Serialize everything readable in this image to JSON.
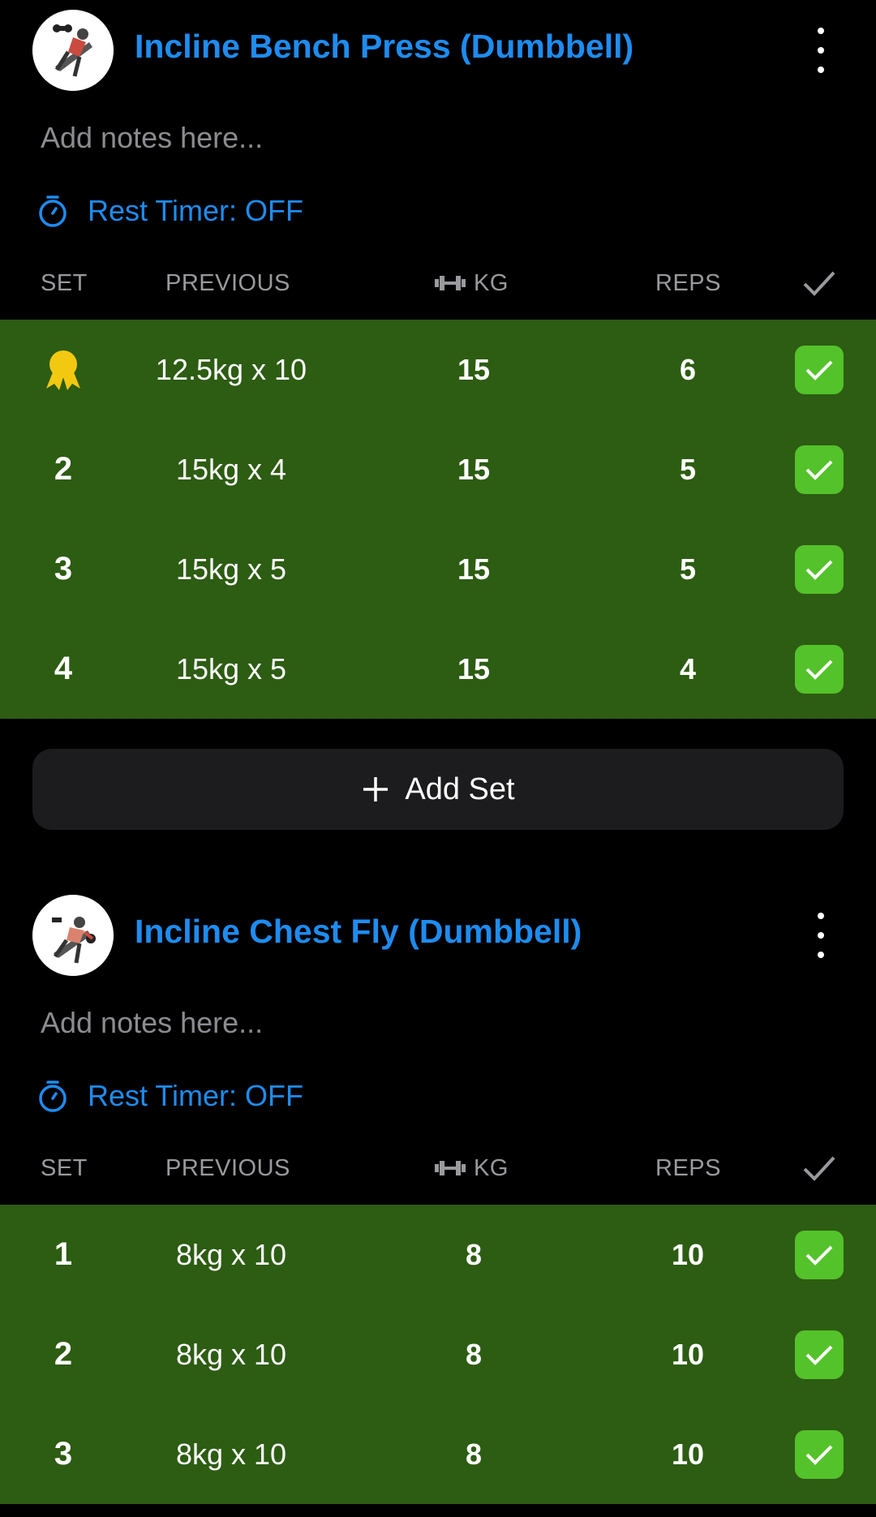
{
  "exercises": [
    {
      "title": "Incline Bench Press (Dumbbell)",
      "notes_placeholder": "Add notes here...",
      "rest_timer": "Rest Timer: OFF",
      "columns": {
        "set": "SET",
        "previous": "PREVIOUS",
        "kg": "KG",
        "reps": "REPS"
      },
      "sets": [
        {
          "set": "",
          "set_icon": "medal-icon",
          "previous": "12.5kg x 10",
          "kg": "15",
          "reps": "6",
          "done": true
        },
        {
          "set": "2",
          "previous": "15kg x 4",
          "kg": "15",
          "reps": "5",
          "done": true
        },
        {
          "set": "3",
          "previous": "15kg x 5",
          "kg": "15",
          "reps": "5",
          "done": true
        },
        {
          "set": "4",
          "previous": "15kg x 5",
          "kg": "15",
          "reps": "4",
          "done": true
        }
      ],
      "add_set_label": "Add Set"
    },
    {
      "title": "Incline Chest Fly (Dumbbell)",
      "notes_placeholder": "Add notes here...",
      "rest_timer": "Rest Timer: OFF",
      "columns": {
        "set": "SET",
        "previous": "PREVIOUS",
        "kg": "KG",
        "reps": "REPS"
      },
      "sets": [
        {
          "set": "1",
          "previous": "8kg x 10",
          "kg": "8",
          "reps": "10",
          "done": true
        },
        {
          "set": "2",
          "previous": "8kg x 10",
          "kg": "8",
          "reps": "10",
          "done": true
        },
        {
          "set": "3",
          "previous": "8kg x 10",
          "kg": "8",
          "reps": "10",
          "done": true
        }
      ]
    }
  ],
  "colors": {
    "accent": "#1e8cf0",
    "row_done_bg": "#2d5c13",
    "check_bg": "#54c22a",
    "medal": "#f2c811"
  }
}
